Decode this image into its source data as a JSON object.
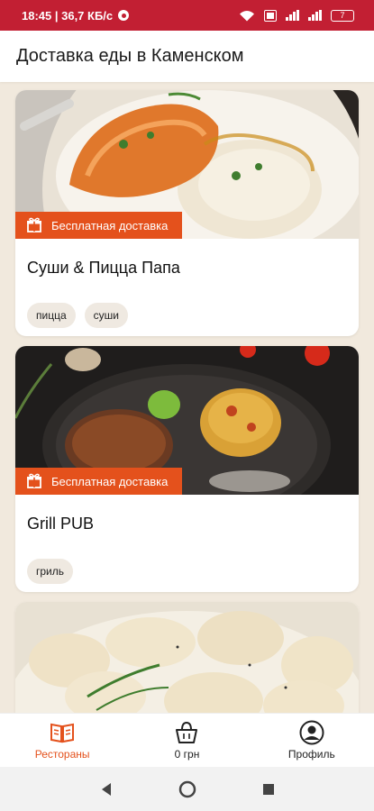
{
  "status_bar": {
    "time_speed": "18:45 | 36,7 КБ/с",
    "battery": "7"
  },
  "app_bar": {
    "title": "Доставка еды в Каменском"
  },
  "restaurants": [
    {
      "name": "Суши & Пицца Папа",
      "promo": "Бесплатная доставка",
      "tags": [
        "пицца",
        "суши"
      ],
      "image_icon": "salmon-puree-dish"
    },
    {
      "name": "Grill PUB",
      "promo": "Бесплатная доставка",
      "tags": [
        "гриль"
      ],
      "image_icon": "grill-steak-potato-dish"
    },
    {
      "image_icon": "dumplings-dish"
    }
  ],
  "bottom_nav": {
    "restaurants_label": "Рестораны",
    "cart_label": "0 грн",
    "profile_label": "Профиль"
  },
  "colors": {
    "status_bar": "#c21f33",
    "accent": "#e4511c",
    "background": "#f1e9dd"
  }
}
